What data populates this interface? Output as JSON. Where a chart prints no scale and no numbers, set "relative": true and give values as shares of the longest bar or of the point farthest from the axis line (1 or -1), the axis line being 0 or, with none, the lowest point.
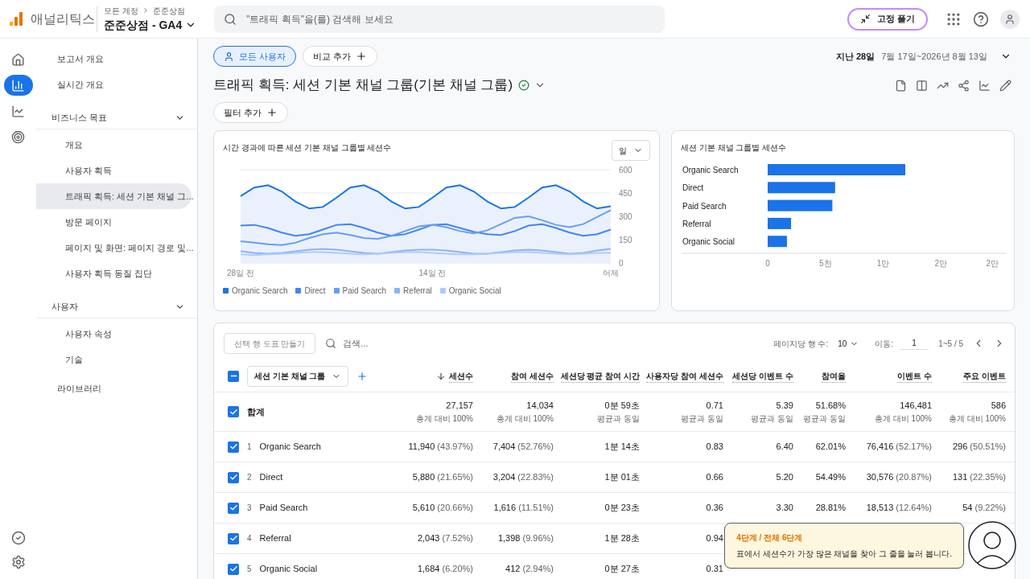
{
  "header": {
    "product": "애널리틱스",
    "breadcrumb": [
      "모든 계정",
      "준준상점"
    ],
    "property": "준준상점 - GA4",
    "search_placeholder": "\"트래픽 획득\"을(를) 검색해 보세요",
    "unpin_button": "고정 풀기"
  },
  "rail": [
    {
      "kind": "home",
      "selected": false
    },
    {
      "kind": "reports",
      "selected": true
    },
    {
      "kind": "explore",
      "selected": false
    },
    {
      "kind": "advertising",
      "selected": false
    }
  ],
  "rail_bottom": [
    {
      "kind": "check"
    },
    {
      "kind": "settings"
    }
  ],
  "nav": [
    {
      "kind": "link",
      "label": "보고서 개요",
      "selected": false
    },
    {
      "kind": "link",
      "label": "실시간 개요",
      "selected": false
    },
    {
      "kind": "section",
      "label": "비즈니스 목표",
      "expanded": true,
      "children": [
        {
          "label": "개요",
          "selected": false
        },
        {
          "label": "사용자 획득",
          "selected": false
        },
        {
          "label": "트래픽 획득: 세션 기본 채널 그...",
          "selected": true
        },
        {
          "label": "방문 페이지",
          "selected": false
        },
        {
          "label": "페이지 및 화면: 페이지 경로 및...",
          "selected": false
        },
        {
          "label": "사용자 획득 동질 집단",
          "selected": false
        }
      ]
    },
    {
      "kind": "section",
      "label": "사용자",
      "expanded": true,
      "children": [
        {
          "label": "사용자 속성",
          "selected": false
        },
        {
          "label": "기술",
          "selected": false
        }
      ]
    },
    {
      "kind": "link",
      "label": "라이브러리",
      "selected": false
    }
  ],
  "segment_chip": "모든 사용자",
  "compare_button": "비교 추가",
  "date_range": {
    "label": "지난 28일",
    "range": "7월 17일~2026년 8월 13일"
  },
  "report_title": "트래픽 획득: 세션 기본 채널 그룹(기본 채널 그룹)",
  "filter_button": "필터 추가",
  "line_card": {
    "title": "시간 경과에 따른 세션 기본 채널 그룹별 세션수",
    "granularity": "일",
    "chart_data": {
      "type": "line",
      "grid": true,
      "categories": [
        "28일 전",
        null,
        null,
        null,
        null,
        null,
        null,
        null,
        null,
        null,
        null,
        null,
        null,
        null,
        "14일 전",
        null,
        null,
        null,
        null,
        null,
        null,
        null,
        null,
        null,
        null,
        null,
        null,
        "어제"
      ],
      "yticks": [
        0,
        150,
        300,
        450,
        600
      ],
      "ylim": [
        0,
        600
      ],
      "series": [
        {
          "name": "Organic Search",
          "color": "#1a73e8",
          "values": [
            430,
            485,
            500,
            460,
            395,
            350,
            360,
            420,
            485,
            500,
            460,
            395,
            350,
            360,
            420,
            485,
            500,
            460,
            395,
            350,
            360,
            420,
            485,
            500,
            460,
            395,
            350,
            365
          ]
        },
        {
          "name": "Direct",
          "color": "#4285f4",
          "values": [
            240,
            245,
            225,
            195,
            175,
            185,
            215,
            245,
            250,
            225,
            195,
            175,
            185,
            215,
            245,
            250,
            225,
            200,
            185,
            180,
            205,
            240,
            250,
            225,
            195,
            175,
            185,
            215
          ]
        },
        {
          "name": "Paid Search",
          "color": "#669df6",
          "values": [
            140,
            130,
            120,
            115,
            130,
            160,
            185,
            195,
            180,
            160,
            155,
            175,
            205,
            235,
            245,
            230,
            205,
            190,
            210,
            250,
            290,
            300,
            275,
            245,
            230,
            250,
            295,
            340
          ]
        },
        {
          "name": "Referral",
          "color": "#8ab4f8",
          "values": [
            75,
            65,
            60,
            65,
            75,
            85,
            90,
            85,
            75,
            65,
            60,
            70,
            80,
            85,
            85,
            80,
            70,
            60,
            60,
            70,
            80,
            85,
            80,
            70,
            60,
            65,
            80,
            90
          ]
        },
        {
          "name": "Organic Social",
          "color": "#aecbfa",
          "values": [
            55,
            50,
            55,
            60,
            65,
            70,
            70,
            65,
            60,
            55,
            60,
            65,
            70,
            70,
            65,
            60,
            55,
            55,
            60,
            65,
            70,
            70,
            65,
            60,
            55,
            60,
            65,
            65
          ]
        }
      ]
    }
  },
  "bar_card": {
    "title": "세션 기본 채널 그룹별 세션수",
    "axis_labels": [
      "0",
      "5천",
      "1만",
      "2만",
      "2만"
    ],
    "chart_data": {
      "type": "bar",
      "orientation": "horizontal",
      "relative": true,
      "categories": [
        "Organic Search",
        "Direct",
        "Paid Search",
        "Referral",
        "Organic Social"
      ],
      "values": [
        1,
        0.49,
        0.47,
        0.17,
        0.14
      ]
    }
  },
  "table": {
    "chart_button": "선택 행 도표 만들기",
    "search_placeholder": "검색...",
    "rows_per_page_label": "페이지당 행 수:",
    "rows_per_page": "10",
    "goto_label": "이동:",
    "goto_value": "1",
    "range": "1~5 / 5",
    "dimension": "세션 기본 채널 그룹",
    "select_all_partial": true,
    "columns": [
      {
        "label": "세션수",
        "sorted": true
      },
      {
        "label": "참여 세션수",
        "sorted": false
      },
      {
        "label": "세션당 평균 참여 시간",
        "sorted": false
      },
      {
        "label": "사용자당 참여 세션수",
        "sorted": false
      },
      {
        "label": "세션당 이벤트 수",
        "sorted": false
      },
      {
        "label": "참여율",
        "sorted": false
      },
      {
        "label": "이벤트 수",
        "sorted": false
      },
      {
        "label": "주요 이벤트",
        "sorted": false
      }
    ],
    "total": {
      "label": "합계",
      "checked": true,
      "cells": [
        {
          "value": "27,157",
          "note": "총계 대비 100%"
        },
        {
          "value": "14,034",
          "note": "총계 대비 100%"
        },
        {
          "value": "0분 59초",
          "note": "평균과 동일"
        },
        {
          "value": "0.71",
          "note": "평균과 동일"
        },
        {
          "value": "5.39",
          "note": "평균과 동일"
        },
        {
          "value": "51.68%",
          "note": "평균과 동일"
        },
        {
          "value": "146,481",
          "note": "총계 대비 100%"
        },
        {
          "value": "586",
          "note": "총계 대비 100%"
        }
      ]
    },
    "rows": [
      {
        "index": "1",
        "name": "Organic Search",
        "checked": true,
        "cells": [
          {
            "value": "11,940",
            "share": "(43.97%)"
          },
          {
            "value": "7,404",
            "share": "(52.76%)"
          },
          {
            "value": "1분 14초"
          },
          {
            "value": "0.83"
          },
          {
            "value": "6.40"
          },
          {
            "value": "62.01%"
          },
          {
            "value": "76,416",
            "share": "(52.17%)"
          },
          {
            "value": "296",
            "share": "(50.51%)"
          }
        ]
      },
      {
        "index": "2",
        "name": "Direct",
        "checked": true,
        "cells": [
          {
            "value": "5,880",
            "share": "(21.65%)"
          },
          {
            "value": "3,204",
            "share": "(22.83%)"
          },
          {
            "value": "1분 01초"
          },
          {
            "value": "0.66"
          },
          {
            "value": "5.20"
          },
          {
            "value": "54.49%"
          },
          {
            "value": "30,576",
            "share": "(20.87%)"
          },
          {
            "value": "131",
            "share": "(22.35%)"
          }
        ]
      },
      {
        "index": "3",
        "name": "Paid Search",
        "checked": true,
        "cells": [
          {
            "value": "5,610",
            "share": "(20.66%)"
          },
          {
            "value": "1,616",
            "share": "(11.51%)"
          },
          {
            "value": "0분 23초"
          },
          {
            "value": "0.36"
          },
          {
            "value": "3.30"
          },
          {
            "value": "28.81%"
          },
          {
            "value": "18,513",
            "share": "(12.64%)"
          },
          {
            "value": "54",
            "share": "(9.22%)"
          }
        ]
      },
      {
        "index": "4",
        "name": "Referral",
        "checked": true,
        "cells": [
          {
            "value": "2,043",
            "share": "(7.52%)"
          },
          {
            "value": "1,398",
            "share": "(9.96%)"
          },
          {
            "value": "1분 28초"
          },
          {
            "value": "0.94"
          }
        ]
      },
      {
        "index": "5",
        "name": "Organic Social",
        "checked": true,
        "cells": [
          {
            "value": "1,684",
            "share": "(6.20%)"
          },
          {
            "value": "412",
            "share": "(2.94%)"
          },
          {
            "value": "0분 27초"
          },
          {
            "value": "0.31"
          }
        ]
      }
    ]
  },
  "guide": {
    "step": "4단계 / 전체 6단계",
    "text": "표에서 세션수가 가장 많은 채널을 찾아 그 줄을 눌러 봅니다."
  }
}
